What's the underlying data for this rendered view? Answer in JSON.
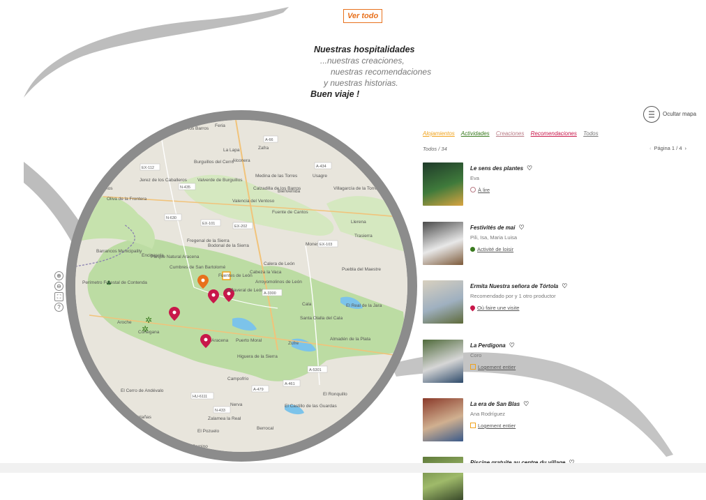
{
  "header": {
    "ver_todo": "Ver todo"
  },
  "intro": {
    "line1": "Nuestras hospitalidades",
    "line2": "...nuestras creaciones,",
    "line3": "nuestras recomendaciones",
    "line4": "y nuestras historias.",
    "line5": "Buen viaje !"
  },
  "map_controls": [
    "⊕",
    "⊖",
    "⛶",
    "?"
  ],
  "map_places": [
    "Salvatierra de los Barros",
    "Feria",
    "La Lapa",
    "Zafra",
    "Burguillos del Cerro",
    "Alconera",
    "Jerez de los Caballeros",
    "Zahínos",
    "Valverde de Burguillos",
    "Medina de las Torres",
    "Calzadilla de los Barros",
    "Bienvenida",
    "Usagre",
    "Villagarcía de la Torre",
    "Oliva de la Frontera",
    "Valencia del Ventoso",
    "Fuente de Cantos",
    "Llerena",
    "Fregenal de la Sierra",
    "Bodonal de la Sierra",
    "Monesterio",
    "Trasierra",
    "Barrancos Municipality",
    "Encinasola",
    "Cumbres de San Bartolomé",
    "Calera de León",
    "Cabeza la Vaca",
    "Fuentes de León",
    "Puebla del Maestre",
    "Cañaveral de León",
    "Arroyomolinos de León",
    "Cala",
    "El Real de la Jara",
    "Aroche",
    "Cortegana",
    "Aracena",
    "Puerto Moral",
    "Santa Olalla del Cala",
    "Zufre",
    "Almadén de la Plata",
    "Higuera de la Sierra",
    "Campofrío",
    "Nerva",
    "El Castillo de las Guardas",
    "El Ronquillo",
    "Zalamea la Real",
    "Berrocal",
    "El Pozuelo",
    "Calañas",
    "Valverde del Camino",
    "El Cerro de Andévalo",
    "Parque Natural Aracena",
    "Perímetro Forestal de Contenda"
  ],
  "map_roads": [
    "EX-112",
    "N-435",
    "EX-101",
    "EX-202",
    "EX-103",
    "N-630",
    "A-66",
    "A-434",
    "A-479",
    "A-461",
    "N-433",
    "HU-6111",
    "A-5301",
    "A-3300"
  ],
  "panel": {
    "ocultar_mapa": "Ocultar mapa",
    "filters": [
      {
        "label": "Alojamientos",
        "color": "#f0a21b"
      },
      {
        "label": "Actividades",
        "color": "#3a7a1f"
      },
      {
        "label": "Creaciones",
        "color": "#b87a84"
      },
      {
        "label": "Recomendaciones",
        "color": "#c8174a"
      },
      {
        "label": "Todos",
        "color": "#777777"
      }
    ],
    "count": "Todos / 34",
    "pager": {
      "prev": "‹",
      "label": "Página 1 / 4",
      "next": "›"
    }
  },
  "cards": [
    {
      "title": "Le sens des plantes",
      "heart": "♡",
      "sub": "Eva",
      "type": "À lire",
      "type_icon": "book-icon",
      "type_color": "#b87a84"
    },
    {
      "title": "Festivités de mai",
      "heart": "♡",
      "sub": "Pili, Isa, Maria Luisa",
      "type": "Activité de loisir",
      "type_icon": "activity-icon",
      "type_color": "#3a7a1f"
    },
    {
      "title": "Ermita Nuestra señora de Tórtola",
      "heart": "♡",
      "sub": "Recomendado por y 1 otro productor",
      "type": "Où faire une visite",
      "type_icon": "pin-icon",
      "type_color": "#c8174a"
    },
    {
      "title": "La Perdigona",
      "heart": "♡",
      "sub": "Coro",
      "type": "Logement entier",
      "type_icon": "lodging-icon",
      "type_color": "#f0a21b"
    },
    {
      "title": "La era de San Blas",
      "heart": "♡",
      "sub": "Ana Rodríguez",
      "type": "Logement entier",
      "type_icon": "lodging-icon",
      "type_color": "#f0a21b"
    },
    {
      "title": "Piscine gratuite au centre du village",
      "heart": "♡",
      "sub": "",
      "type": "",
      "type_icon": "",
      "type_color": "#777777"
    }
  ]
}
